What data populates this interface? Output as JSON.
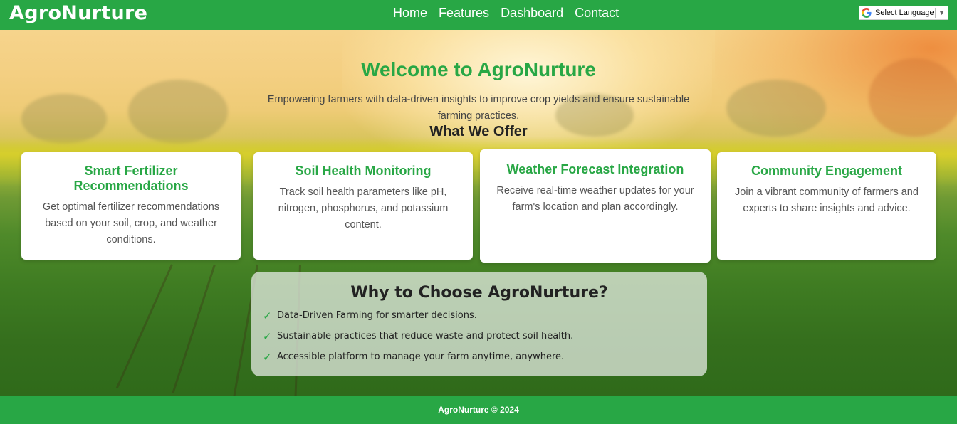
{
  "navbar": {
    "logo": "AgroNurture",
    "links": [
      "Home",
      "Features",
      "Dashboard",
      "Contact"
    ],
    "language_select": {
      "icon": "google-g-icon",
      "label": "Select Language",
      "arrow": "▼"
    }
  },
  "hero": {
    "title": "Welcome to AgroNurture",
    "subtitle": "Empowering farmers with data-driven insights to improve crop yields and ensure sustainable farming practices."
  },
  "offer": {
    "title": "What We Offer",
    "cards": [
      {
        "title": "Smart Fertilizer Recommendations",
        "description": "Get optimal fertilizer recommendations based on your soil, crop, and weather conditions."
      },
      {
        "title": "Soil Health Monitoring",
        "description": "Track soil health parameters like pH, nitrogen, phosphorus, and potassium content."
      },
      {
        "title": "Weather Forecast Integration",
        "description": "Receive real-time weather updates for your farm's location and plan accordingly."
      },
      {
        "title": "Community Engagement",
        "description": "Join a vibrant community of farmers and experts to share insights and advice."
      }
    ]
  },
  "why": {
    "title": "Why to Choose AgroNurture?",
    "check_glyph": "✓",
    "items": [
      "Data-Driven Farming for smarter decisions.",
      "Sustainable practices that reduce waste and protect soil health.",
      "Accessible platform to manage your farm anytime, anywhere."
    ]
  },
  "footer": {
    "text": "AgroNurture © 2024"
  },
  "colors": {
    "brand_green": "#28a745",
    "card_bg": "#ffffff",
    "text_dark": "#222222",
    "text_muted": "#555555"
  }
}
